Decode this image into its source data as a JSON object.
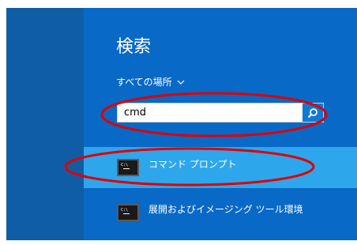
{
  "search": {
    "title": "検索",
    "scope_label": "すべての場所",
    "query": "cmd"
  },
  "results": [
    {
      "label": "コマンド プロンプト",
      "icon": "command-prompt-icon",
      "selected": true
    },
    {
      "label": "展開およびイメージング ツール環境",
      "icon": "command-prompt-icon",
      "selected": false
    }
  ],
  "colors": {
    "pane": "#0969c7",
    "left_pane": "#0f5ea5",
    "selected": "#2ea6ec",
    "annotation": "#e00000"
  }
}
